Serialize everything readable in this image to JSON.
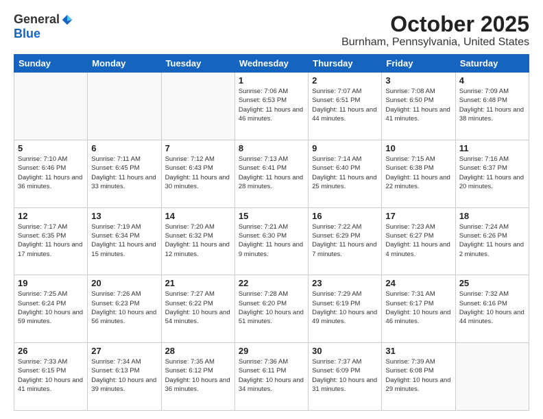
{
  "header": {
    "logo_general": "General",
    "logo_blue": "Blue",
    "title": "October 2025",
    "subtitle": "Burnham, Pennsylvania, United States"
  },
  "weekdays": [
    "Sunday",
    "Monday",
    "Tuesday",
    "Wednesday",
    "Thursday",
    "Friday",
    "Saturday"
  ],
  "weeks": [
    [
      {
        "day": "",
        "info": ""
      },
      {
        "day": "",
        "info": ""
      },
      {
        "day": "",
        "info": ""
      },
      {
        "day": "1",
        "info": "Sunrise: 7:06 AM\nSunset: 6:53 PM\nDaylight: 11 hours\nand 46 minutes."
      },
      {
        "day": "2",
        "info": "Sunrise: 7:07 AM\nSunset: 6:51 PM\nDaylight: 11 hours\nand 44 minutes."
      },
      {
        "day": "3",
        "info": "Sunrise: 7:08 AM\nSunset: 6:50 PM\nDaylight: 11 hours\nand 41 minutes."
      },
      {
        "day": "4",
        "info": "Sunrise: 7:09 AM\nSunset: 6:48 PM\nDaylight: 11 hours\nand 38 minutes."
      }
    ],
    [
      {
        "day": "5",
        "info": "Sunrise: 7:10 AM\nSunset: 6:46 PM\nDaylight: 11 hours\nand 36 minutes."
      },
      {
        "day": "6",
        "info": "Sunrise: 7:11 AM\nSunset: 6:45 PM\nDaylight: 11 hours\nand 33 minutes."
      },
      {
        "day": "7",
        "info": "Sunrise: 7:12 AM\nSunset: 6:43 PM\nDaylight: 11 hours\nand 30 minutes."
      },
      {
        "day": "8",
        "info": "Sunrise: 7:13 AM\nSunset: 6:41 PM\nDaylight: 11 hours\nand 28 minutes."
      },
      {
        "day": "9",
        "info": "Sunrise: 7:14 AM\nSunset: 6:40 PM\nDaylight: 11 hours\nand 25 minutes."
      },
      {
        "day": "10",
        "info": "Sunrise: 7:15 AM\nSunset: 6:38 PM\nDaylight: 11 hours\nand 22 minutes."
      },
      {
        "day": "11",
        "info": "Sunrise: 7:16 AM\nSunset: 6:37 PM\nDaylight: 11 hours\nand 20 minutes."
      }
    ],
    [
      {
        "day": "12",
        "info": "Sunrise: 7:17 AM\nSunset: 6:35 PM\nDaylight: 11 hours\nand 17 minutes."
      },
      {
        "day": "13",
        "info": "Sunrise: 7:19 AM\nSunset: 6:34 PM\nDaylight: 11 hours\nand 15 minutes."
      },
      {
        "day": "14",
        "info": "Sunrise: 7:20 AM\nSunset: 6:32 PM\nDaylight: 11 hours\nand 12 minutes."
      },
      {
        "day": "15",
        "info": "Sunrise: 7:21 AM\nSunset: 6:30 PM\nDaylight: 11 hours\nand 9 minutes."
      },
      {
        "day": "16",
        "info": "Sunrise: 7:22 AM\nSunset: 6:29 PM\nDaylight: 11 hours\nand 7 minutes."
      },
      {
        "day": "17",
        "info": "Sunrise: 7:23 AM\nSunset: 6:27 PM\nDaylight: 11 hours\nand 4 minutes."
      },
      {
        "day": "18",
        "info": "Sunrise: 7:24 AM\nSunset: 6:26 PM\nDaylight: 11 hours\nand 2 minutes."
      }
    ],
    [
      {
        "day": "19",
        "info": "Sunrise: 7:25 AM\nSunset: 6:24 PM\nDaylight: 10 hours\nand 59 minutes."
      },
      {
        "day": "20",
        "info": "Sunrise: 7:26 AM\nSunset: 6:23 PM\nDaylight: 10 hours\nand 56 minutes."
      },
      {
        "day": "21",
        "info": "Sunrise: 7:27 AM\nSunset: 6:22 PM\nDaylight: 10 hours\nand 54 minutes."
      },
      {
        "day": "22",
        "info": "Sunrise: 7:28 AM\nSunset: 6:20 PM\nDaylight: 10 hours\nand 51 minutes."
      },
      {
        "day": "23",
        "info": "Sunrise: 7:29 AM\nSunset: 6:19 PM\nDaylight: 10 hours\nand 49 minutes."
      },
      {
        "day": "24",
        "info": "Sunrise: 7:31 AM\nSunset: 6:17 PM\nDaylight: 10 hours\nand 46 minutes."
      },
      {
        "day": "25",
        "info": "Sunrise: 7:32 AM\nSunset: 6:16 PM\nDaylight: 10 hours\nand 44 minutes."
      }
    ],
    [
      {
        "day": "26",
        "info": "Sunrise: 7:33 AM\nSunset: 6:15 PM\nDaylight: 10 hours\nand 41 minutes."
      },
      {
        "day": "27",
        "info": "Sunrise: 7:34 AM\nSunset: 6:13 PM\nDaylight: 10 hours\nand 39 minutes."
      },
      {
        "day": "28",
        "info": "Sunrise: 7:35 AM\nSunset: 6:12 PM\nDaylight: 10 hours\nand 36 minutes."
      },
      {
        "day": "29",
        "info": "Sunrise: 7:36 AM\nSunset: 6:11 PM\nDaylight: 10 hours\nand 34 minutes."
      },
      {
        "day": "30",
        "info": "Sunrise: 7:37 AM\nSunset: 6:09 PM\nDaylight: 10 hours\nand 31 minutes."
      },
      {
        "day": "31",
        "info": "Sunrise: 7:39 AM\nSunset: 6:08 PM\nDaylight: 10 hours\nand 29 minutes."
      },
      {
        "day": "",
        "info": ""
      }
    ]
  ]
}
